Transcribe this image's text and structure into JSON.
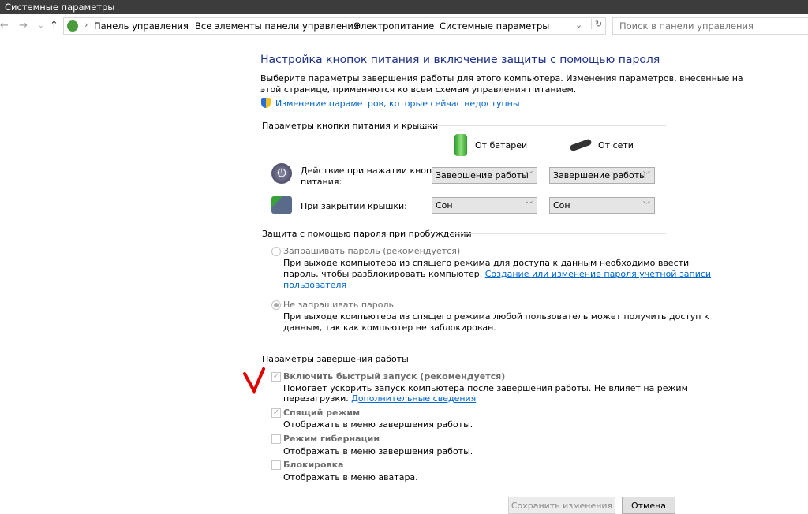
{
  "window": {
    "title": "Системные параметры"
  },
  "nav": {
    "back_icon": "arrow-left",
    "forward_icon": "arrow-right",
    "recent_icon": "chevron-down",
    "up_icon": "arrow-up",
    "breadcrumbs": [
      "Панель управления",
      "Все элементы панели управления",
      "Электропитание",
      "Системные параметры"
    ],
    "search_placeholder": "Поиск в панели управления"
  },
  "main": {
    "title": "Настройка кнопок питания и включение защиты с помощью пароля",
    "intro": "Выберите параметры завершения работы для этого компьютера. Изменения параметров, внесенные на этой странице, применяются ко всем схемам управления питанием.",
    "intro_line1": "Выберите параметры завершения работы для этого компьютера. Изменения параметров, внесенные на",
    "intro_line2": "этой странице, применяются ко всем схемам управления питанием.",
    "admin_link": "Изменение параметров, которые сейчас недоступны",
    "power_group": {
      "label": "Параметры кнопки питания и крышки",
      "battery": "От батареи",
      "ac": "От сети",
      "rows": [
        {
          "label1": "Действие при нажатии кнопки",
          "label2": "питания:",
          "battery": "Завершение работы",
          "ac": "Завершение работы"
        },
        {
          "label1": "При закрытии крышки:",
          "label2": "",
          "battery": "Сон",
          "ac": "Сон"
        }
      ]
    },
    "password_group": {
      "label": "Защита с помощью пароля при пробуждении",
      "require": {
        "label": "Запрашивать пароль (рекомендуется)",
        "selected": false,
        "desc1": "При выходе компьютера из спящего режима для доступа к данным необходимо ввести",
        "desc2": "пароль, чтобы разблокировать компьютер.",
        "link1": "Создание или изменение пароля учетной записи",
        "link2": "пользователя"
      },
      "norequire": {
        "label": "Не запрашивать пароль",
        "selected": true,
        "desc1": "При выходе компьютера из спящего режима любой пользователь может получить доступ к",
        "desc2": "данным, так как компьютер не заблокирован."
      }
    },
    "shutdown_group": {
      "label": "Параметры завершения работы",
      "items": [
        {
          "label": "Включить быстрый запуск (рекомендуется)",
          "checked": true,
          "desc1": "Помогает ускорить запуск компьютера после завершения работы. Не влияет на режим",
          "desc2": "перезагрузки.",
          "link": "Дополнительные сведения"
        },
        {
          "label": "Спящий режим",
          "checked": true,
          "desc1": "Отображать в меню завершения работы."
        },
        {
          "label": "Режим гибернации",
          "checked": false,
          "desc1": "Отображать в меню завершения работы."
        },
        {
          "label": "Блокировка",
          "checked": false,
          "desc1": "Отображать в меню аватара."
        }
      ]
    }
  },
  "footer": {
    "save": "Сохранить изменения",
    "cancel": "Отмена"
  },
  "annotation_color": "#e00000"
}
